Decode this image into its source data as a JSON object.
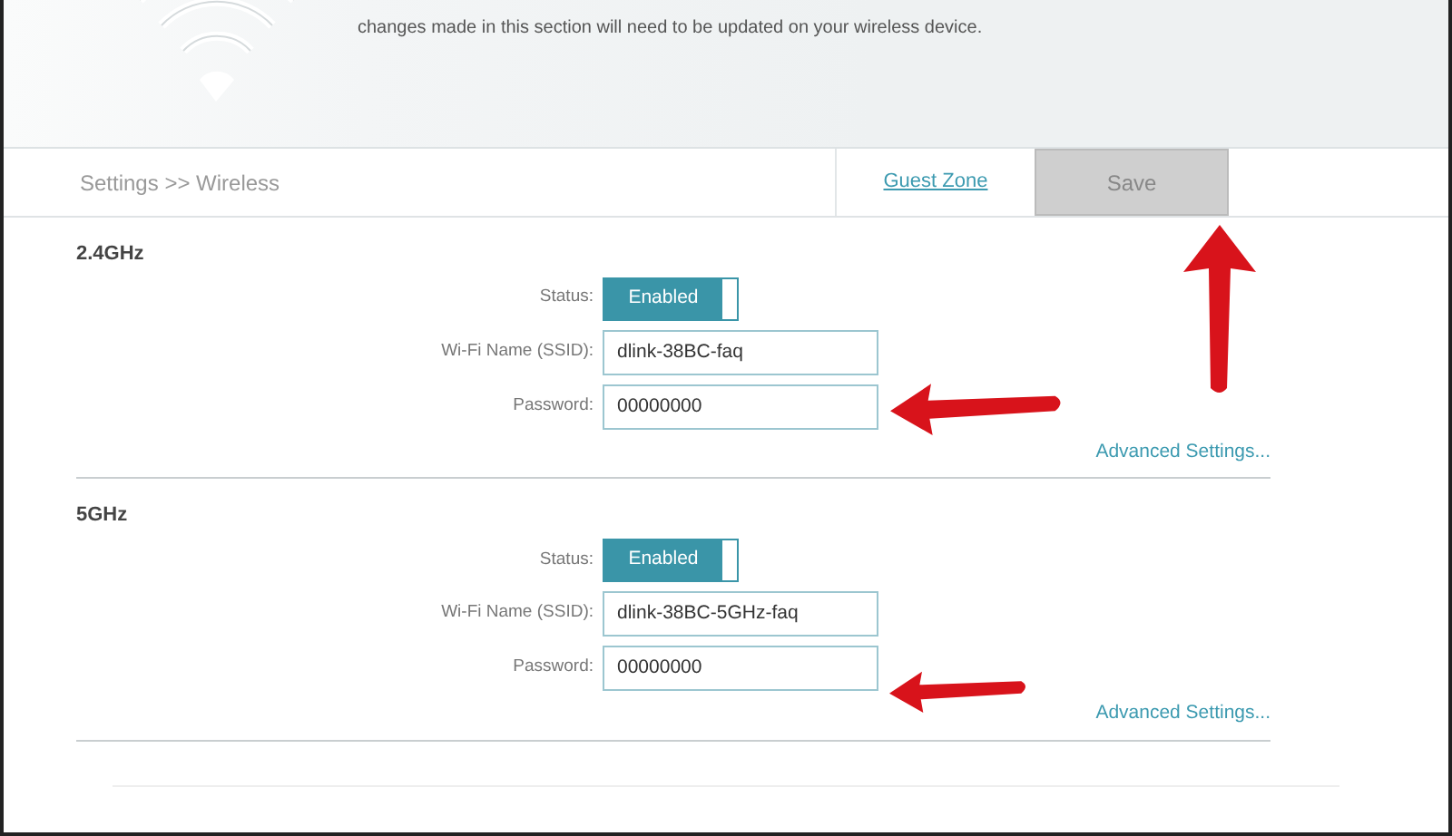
{
  "header": {
    "intro": "changes made in this section will need to be updated on your wireless device."
  },
  "breadcrumb": "Settings >> Wireless",
  "actions": {
    "link": "Guest Zone",
    "save": {
      "label": "Save",
      "disabled": true
    }
  },
  "bands": [
    {
      "title": "2.4GHz",
      "status": {
        "label": "Status:",
        "value": "Enabled",
        "on": true
      },
      "ssid": {
        "label": "Wi-Fi Name (SSID):",
        "value": "dlink-38BC-faq"
      },
      "password": {
        "label": "Password:",
        "value": "00000000"
      },
      "advanced": "Advanced Settings..."
    },
    {
      "title": "5GHz",
      "status": {
        "label": "Status:",
        "value": "Enabled",
        "on": true
      },
      "ssid": {
        "label": "Wi-Fi Name (SSID):",
        "value": "dlink-38BC-5GHz-faq"
      },
      "password": {
        "label": "Password:",
        "value": "00000000"
      },
      "advanced": "Advanced Settings..."
    }
  ],
  "arrows": [
    {
      "kind": "up"
    },
    {
      "kind": "left"
    },
    {
      "kind": "left"
    }
  ]
}
